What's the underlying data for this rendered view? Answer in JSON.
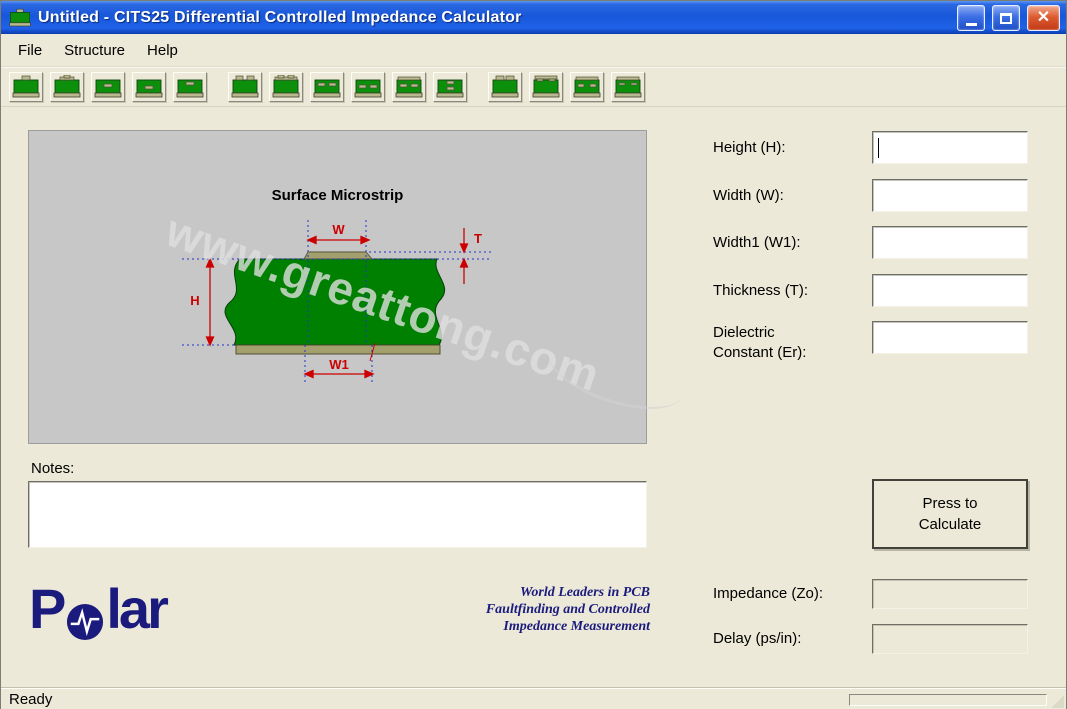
{
  "window": {
    "title": "Untitled - CITS25 Differential Controlled Impedance Calculator",
    "app_icon": "pcb-board-icon",
    "controls": {
      "minimize": "minimize",
      "maximize": "maximize",
      "close": "close"
    }
  },
  "menu": {
    "items": [
      "File",
      "Structure",
      "Help"
    ]
  },
  "toolbar": {
    "buttons": [
      {
        "name": "tool-surface-microstrip",
        "group": 0,
        "marks": [
          [
            11,
            1,
            8,
            4
          ]
        ]
      },
      {
        "name": "tool-coated-microstrip",
        "group": 0,
        "marks": [
          [
            8,
            2,
            14,
            3
          ],
          [
            12,
            0,
            6,
            3
          ]
        ]
      },
      {
        "name": "tool-embedded-microstrip",
        "group": 0,
        "marks": [
          [
            11,
            9,
            8,
            3
          ]
        ]
      },
      {
        "name": "tool-stripline",
        "group": 0,
        "marks": [
          [
            11,
            11,
            8,
            3
          ]
        ]
      },
      {
        "name": "tool-offset-stripline",
        "group": 0,
        "marks": [
          [
            11,
            7,
            8,
            3
          ]
        ]
      },
      {
        "name": "tool-diff-surface-microstrip",
        "group": 1,
        "marks": [
          [
            6,
            1,
            7,
            4
          ],
          [
            17,
            1,
            7,
            4
          ]
        ]
      },
      {
        "name": "tool-diff-coated-microstrip",
        "group": 1,
        "marks": [
          [
            4,
            2,
            22,
            3
          ],
          [
            7,
            0,
            6,
            3
          ],
          [
            17,
            0,
            6,
            3
          ]
        ]
      },
      {
        "name": "tool-diff-embedded-microstrip",
        "group": 1,
        "marks": [
          [
            6,
            8,
            7,
            3
          ],
          [
            17,
            8,
            7,
            3
          ]
        ]
      },
      {
        "name": "tool-diff-stripline",
        "group": 1,
        "marks": [
          [
            6,
            10,
            7,
            3
          ],
          [
            17,
            10,
            7,
            3
          ]
        ]
      },
      {
        "name": "tool-diff-offset-stripline",
        "group": 1,
        "marks": [
          [
            4,
            2,
            22,
            3
          ],
          [
            6,
            9,
            7,
            3
          ],
          [
            17,
            9,
            7,
            3
          ]
        ]
      },
      {
        "name": "tool-diff-broadside-coupled",
        "group": 1,
        "marks": [
          [
            12,
            6,
            7,
            3
          ],
          [
            12,
            12,
            7,
            3
          ]
        ]
      },
      {
        "name": "tool-diff-surface-2",
        "group": 2,
        "marks": [
          [
            6,
            1,
            8,
            4
          ],
          [
            16,
            1,
            8,
            4
          ]
        ]
      },
      {
        "name": "tool-diff-coated-2",
        "group": 2,
        "marks": [
          [
            4,
            1,
            22,
            3
          ],
          [
            6,
            4,
            6,
            2
          ],
          [
            18,
            4,
            6,
            2
          ]
        ]
      },
      {
        "name": "tool-diff-embedded-2",
        "group": 2,
        "marks": [
          [
            4,
            2,
            22,
            3
          ],
          [
            6,
            9,
            6,
            3
          ],
          [
            18,
            9,
            6,
            3
          ]
        ]
      },
      {
        "name": "tool-diff-stripline-2",
        "group": 2,
        "marks": [
          [
            4,
            2,
            22,
            3
          ],
          [
            6,
            8,
            6,
            2
          ],
          [
            18,
            8,
            6,
            2
          ]
        ]
      }
    ]
  },
  "diagram": {
    "title": "Surface Microstrip",
    "watermark": "www.greattong.com",
    "labels": {
      "w": "W",
      "t": "T",
      "h": "H",
      "w1": "W1"
    }
  },
  "inputs": [
    {
      "label": "Height (H):",
      "value": "",
      "focused": true
    },
    {
      "label": "Width (W):",
      "value": ""
    },
    {
      "label": "Width1 (W1):",
      "value": ""
    },
    {
      "label": "Thickness (T):",
      "value": ""
    },
    {
      "label": "Dielectric Constant (Er):",
      "value": ""
    }
  ],
  "notes": {
    "label": "Notes:",
    "value": ""
  },
  "calculate": {
    "label": "Press to Calculate"
  },
  "results": [
    {
      "label": "Impedance (Zo):",
      "value": ""
    },
    {
      "label": "Delay (ps/in):",
      "value": ""
    }
  ],
  "branding": {
    "logo_first": "P",
    "logo_rest": "lar",
    "logo_alt": "Polar",
    "logo_o_icon": "pulse-waveform-icon",
    "tagline": [
      "World Leaders in PCB",
      "Faultfinding and Controlled",
      "Impedance Measurement"
    ]
  },
  "statusbar": {
    "text": "Ready"
  },
  "colors": {
    "titlebar_blue": "#1757d9",
    "close_red": "#dd5c33",
    "bg_beige": "#ece9d8",
    "panel_gray": "#c7c7c7",
    "pcb_green": "#008000",
    "trace_tan": "#a3a06e",
    "dimension_red": "#cc0000",
    "guide_blue": "#2233cc",
    "brand_navy": "#1b1b7e"
  }
}
